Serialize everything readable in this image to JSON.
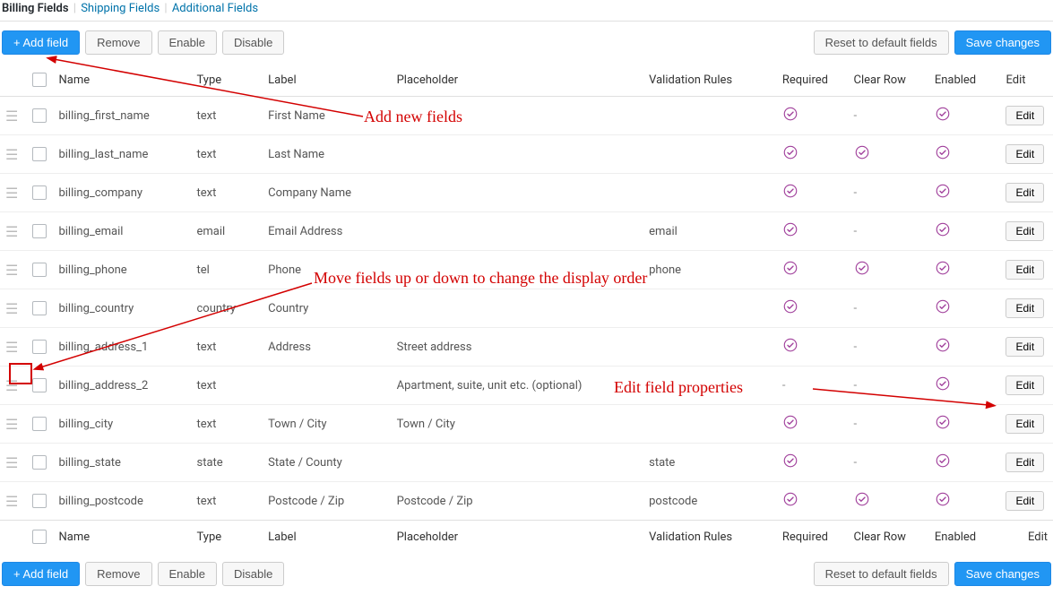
{
  "tabs": {
    "billing": "Billing Fields",
    "shipping": "Shipping Fields",
    "additional": "Additional Fields"
  },
  "buttons": {
    "add_field": "+ Add field",
    "remove": "Remove",
    "enable": "Enable",
    "disable": "Disable",
    "reset": "Reset to default fields",
    "save": "Save changes",
    "edit": "Edit"
  },
  "columns": {
    "name": "Name",
    "type": "Type",
    "label": "Label",
    "placeholder": "Placeholder",
    "validation": "Validation Rules",
    "required": "Required",
    "clear": "Clear Row",
    "enabled": "Enabled",
    "edit": "Edit"
  },
  "rows": [
    {
      "name": "billing_first_name",
      "type": "text",
      "label": "First Name",
      "placeholder": "",
      "validation": "",
      "required": true,
      "clear": false,
      "enabled": true
    },
    {
      "name": "billing_last_name",
      "type": "text",
      "label": "Last Name",
      "placeholder": "",
      "validation": "",
      "required": true,
      "clear": true,
      "enabled": true
    },
    {
      "name": "billing_company",
      "type": "text",
      "label": "Company Name",
      "placeholder": "",
      "validation": "",
      "required": true,
      "clear": false,
      "enabled": true
    },
    {
      "name": "billing_email",
      "type": "email",
      "label": "Email Address",
      "placeholder": "",
      "validation": "email",
      "required": true,
      "clear": false,
      "enabled": true
    },
    {
      "name": "billing_phone",
      "type": "tel",
      "label": "Phone",
      "placeholder": "",
      "validation": "phone",
      "required": true,
      "clear": true,
      "enabled": true
    },
    {
      "name": "billing_country",
      "type": "country",
      "label": "Country",
      "placeholder": "",
      "validation": "",
      "required": true,
      "clear": false,
      "enabled": true
    },
    {
      "name": "billing_address_1",
      "type": "text",
      "label": "Address",
      "placeholder": "Street address",
      "validation": "",
      "required": true,
      "clear": false,
      "enabled": true
    },
    {
      "name": "billing_address_2",
      "type": "text",
      "label": "",
      "placeholder": "Apartment, suite, unit etc. (optional)",
      "validation": "",
      "required": false,
      "clear": false,
      "enabled": true
    },
    {
      "name": "billing_city",
      "type": "text",
      "label": "Town / City",
      "placeholder": "Town / City",
      "validation": "",
      "required": true,
      "clear": false,
      "enabled": true
    },
    {
      "name": "billing_state",
      "type": "state",
      "label": "State / County",
      "placeholder": "",
      "validation": "state",
      "required": true,
      "clear": false,
      "enabled": true
    },
    {
      "name": "billing_postcode",
      "type": "text",
      "label": "Postcode / Zip",
      "placeholder": "Postcode / Zip",
      "validation": "postcode",
      "required": true,
      "clear": true,
      "enabled": true
    }
  ],
  "annotations": {
    "add_new": "Add new fields",
    "move": "Move fields up or down to change the display order",
    "edit_props": "Edit field properties"
  }
}
